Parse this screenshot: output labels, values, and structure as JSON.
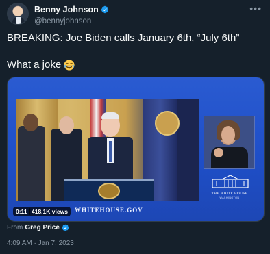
{
  "author": {
    "display_name": "Benny Johnson",
    "handle": "@bennyjohnson"
  },
  "tweet": {
    "line1": "BREAKING: Joe Biden calls January 6th, “July 6th”",
    "line2": "What a joke"
  },
  "media": {
    "duration": "0:11",
    "views": "418.1K views",
    "watermark_url": "WHITEHOUSE.GOV",
    "seal_title": "THE WHITE HOUSE",
    "seal_subtitle": "WASHINGTON"
  },
  "attribution": {
    "prefix": "From",
    "source": "Greg Price"
  },
  "timestamp": "4:09 AM · Jan 7, 2023",
  "colors": {
    "background": "#15202b",
    "verified": "#1d9bf0",
    "secondary_text": "#8b98a5",
    "media_blue": "#2a5bd1"
  },
  "icons": [
    "verified-badge-icon",
    "more-options-icon",
    "joy-emoji-icon"
  ]
}
